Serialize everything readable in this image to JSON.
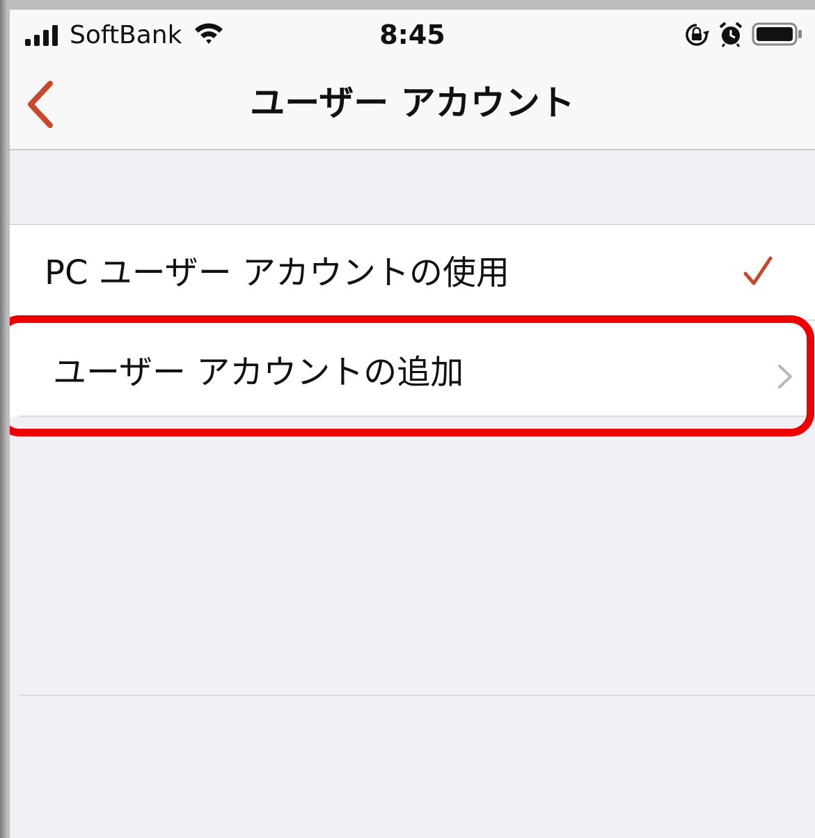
{
  "status_bar": {
    "carrier": "SoftBank",
    "time": "8:45"
  },
  "nav": {
    "title": "ユーザー アカウント"
  },
  "list": {
    "items": [
      {
        "label": "PC ユーザー アカウントの使用",
        "accessory": "checkmark-icon"
      },
      {
        "label": "ユーザー アカウントの追加",
        "accessory": "chevron-right-icon"
      }
    ]
  },
  "colors": {
    "accent": "#c8482b",
    "highlight": "#ee0000",
    "background": "#f1f0f6"
  }
}
